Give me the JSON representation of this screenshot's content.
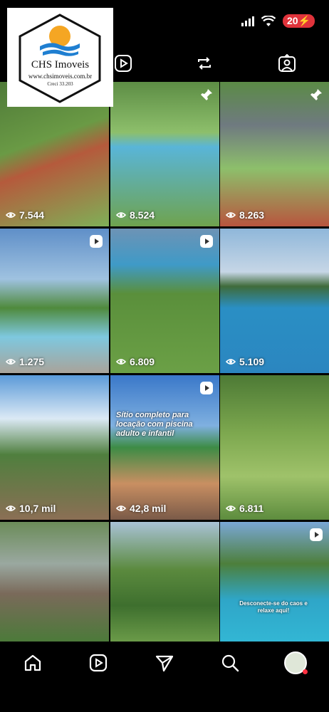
{
  "status": {
    "battery": "20"
  },
  "logo": {
    "brand": "CHS Imoveis",
    "url": "www.chsimoveis.com.br",
    "creci": "Creci 33.203"
  },
  "tabs": [
    "grid-tab",
    "reels-tab",
    "reposts-tab",
    "tagged-tab"
  ],
  "posts": [
    {
      "views": "7.544",
      "pinned": true
    },
    {
      "views": "8.524",
      "pinned": true
    },
    {
      "views": "8.263",
      "pinned": true
    },
    {
      "views": "1.275",
      "reel": true
    },
    {
      "views": "6.809",
      "reel": true
    },
    {
      "views": "5.109"
    },
    {
      "views": "10,7 mil"
    },
    {
      "views": "42,8 mil",
      "reel": true,
      "caption": "Sítio completo para locação com piscina adulto e infantil"
    },
    {
      "views": "6.811"
    },
    {
      "views": ""
    },
    {
      "views": ""
    },
    {
      "views": "",
      "reel": true,
      "caption": "Desconecte-se do caos e relaxe aqui!"
    }
  ],
  "colors": {
    "badge": "#e0333b",
    "background": "#000000"
  }
}
